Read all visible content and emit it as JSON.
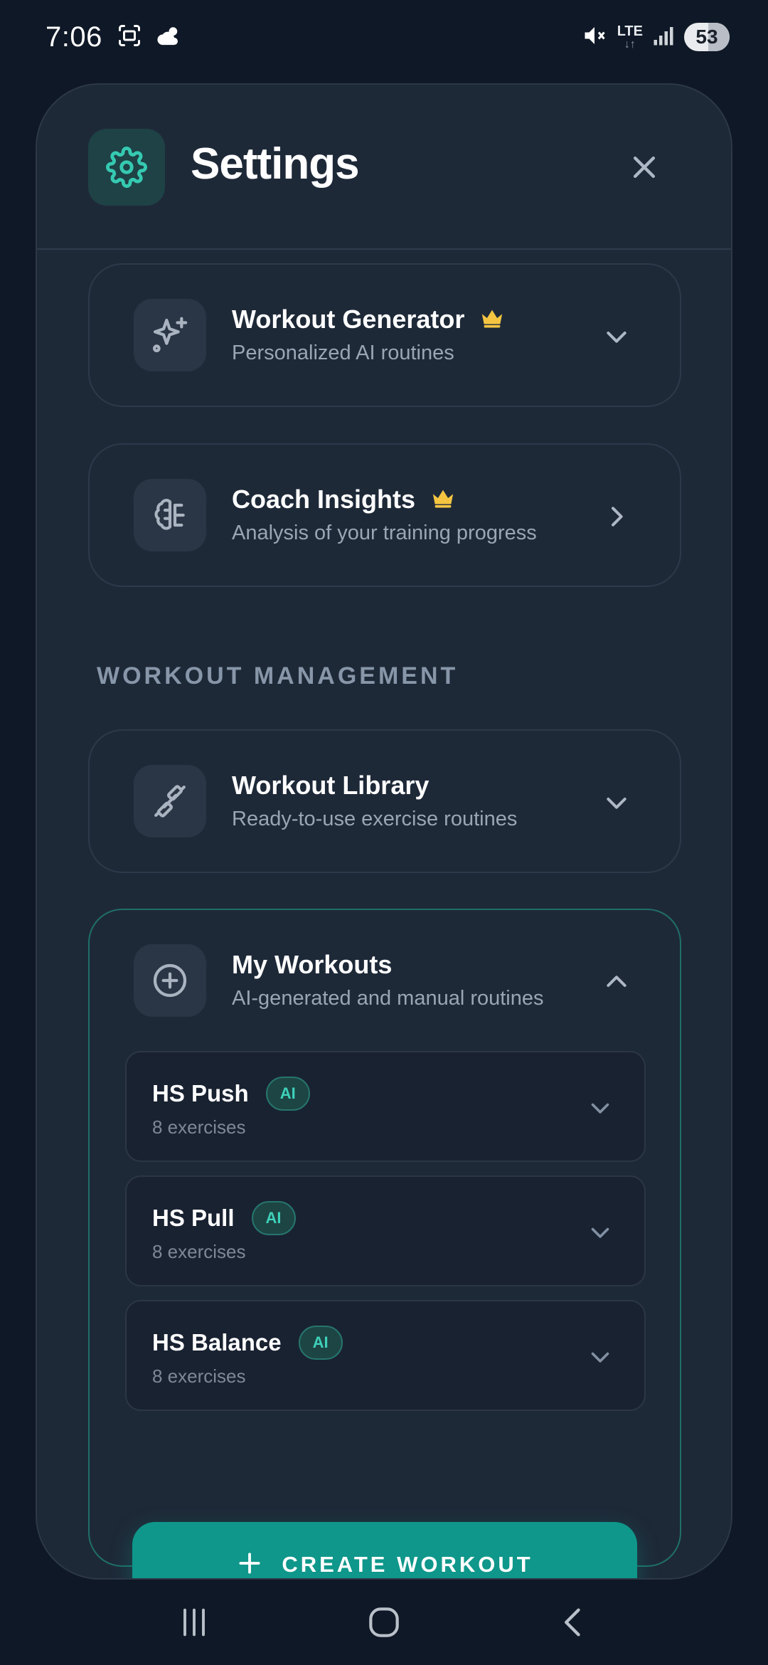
{
  "status_bar": {
    "time": "7:06",
    "network": "LTE",
    "network_arrows": "↓↑",
    "battery": "53",
    "icons": [
      "screenshot-icon",
      "weather-icon",
      "mute-icon",
      "signal-icon"
    ]
  },
  "header": {
    "title": "Settings",
    "icon": "gear-icon",
    "close_icon": "close-icon"
  },
  "colors": {
    "accent": "#0e978a",
    "accent_text": "#3ed1ba",
    "premium": "#f5c542",
    "background": "#0f1826",
    "sheet": "#1e2938"
  },
  "cards": [
    {
      "title": "Workout Generator",
      "subtitle": "Personalized AI routines",
      "icon": "sparkles-icon",
      "premium": true,
      "state": "collapsed"
    },
    {
      "title": "Coach Insights",
      "subtitle": "Analysis of your training progress",
      "icon": "brain-icon",
      "premium": true,
      "state": "link"
    }
  ],
  "section": {
    "label": "WORKOUT MANAGEMENT"
  },
  "library": {
    "title": "Workout Library",
    "subtitle": "Ready-to-use exercise routines",
    "icon": "dumbbell-icon",
    "state": "collapsed"
  },
  "my_workouts": {
    "title": "My Workouts",
    "subtitle": "AI-generated and manual routines",
    "icon": "plus-circle-icon",
    "state": "expanded",
    "items": [
      {
        "name": "HS Push",
        "badge": "AI",
        "count": "8 exercises"
      },
      {
        "name": "HS Pull",
        "badge": "AI",
        "count": "8 exercises"
      },
      {
        "name": "HS Balance",
        "badge": "AI",
        "count": "8 exercises"
      }
    ],
    "create_label": "CREATE WORKOUT"
  },
  "nav": {
    "items": [
      "recents-icon",
      "home-icon",
      "back-icon"
    ]
  }
}
